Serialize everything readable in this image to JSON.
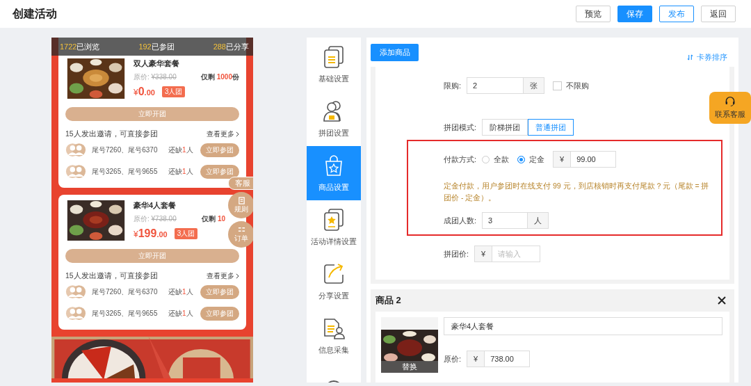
{
  "header": {
    "title": "创建活动",
    "buttons": [
      {
        "label": "预览",
        "kind": "default"
      },
      {
        "label": "保存",
        "kind": "primary"
      },
      {
        "label": "发布",
        "kind": "outline"
      },
      {
        "label": "返回",
        "kind": "default"
      }
    ]
  },
  "preview": {
    "stats": [
      {
        "count": "1722",
        "label": "已浏览"
      },
      {
        "count": "192",
        "label": "已参团"
      },
      {
        "count": "288",
        "label": "已分享"
      }
    ],
    "deals": [
      {
        "title": "双人豪华套餐",
        "original_label": "原价:",
        "original_price": "¥338.00",
        "stock_prefix": "仅剩",
        "stock": "1000",
        "stock_unit": "份",
        "currency": "¥",
        "price_int": "0",
        "price_dec": ".00",
        "group_size": "3人团",
        "start_button": "立即开团",
        "invite_text": "15人发出邀请，可直接参团",
        "more_link": "查看更多",
        "groups": [
          {
            "members": "尾号7260、尾号6370",
            "missing_prefix": "还缺",
            "missing": "1",
            "missing_suffix": "人",
            "join_button": "立即参团"
          },
          {
            "members": "尾号3265、尾号9655",
            "missing_prefix": "还缺",
            "missing": "1",
            "missing_suffix": "人",
            "join_button": "立即参团"
          }
        ]
      },
      {
        "title": "豪华4人套餐",
        "original_label": "原价:",
        "original_price": "¥738.00",
        "stock_prefix": "仅剩",
        "stock": "10",
        "currency": "¥",
        "price_int": "199",
        "price_dec": ".00",
        "group_size": "3人团",
        "start_button": "立即开团",
        "invite_text": "15人发出邀请，可直接参团",
        "more_link": "查看更多",
        "groups": [
          {
            "members": "尾号7260、尾号6370",
            "missing_prefix": "还缺",
            "missing": "1",
            "missing_suffix": "人",
            "join_button": "立即参团"
          },
          {
            "members": "尾号3265、尾号9655",
            "missing_prefix": "还缺",
            "missing": "1",
            "missing_suffix": "人",
            "join_button": "立即参团"
          }
        ]
      }
    ],
    "floating": [
      {
        "label": "客服",
        "kind": "tab"
      },
      {
        "label": "规则",
        "kind": "rules"
      },
      {
        "label": "订单",
        "kind": "orders"
      }
    ]
  },
  "nav": [
    {
      "label": "基础设置",
      "selected": false
    },
    {
      "label": "拼团设置",
      "selected": false
    },
    {
      "label": "商品设置",
      "selected": true
    },
    {
      "label": "活动详情设置",
      "selected": false
    },
    {
      "label": "分享设置",
      "selected": false
    },
    {
      "label": "信息采集",
      "selected": false
    },
    {
      "selected": false
    }
  ],
  "products": {
    "add_button": "添加商品",
    "sort_link": "卡券排序",
    "item1": {
      "limit": {
        "label": "限购:",
        "value": "2",
        "unit": "张",
        "unlimited": {
          "label": "不限购",
          "checked": false
        }
      },
      "mode": {
        "label": "拼团模式:",
        "options": [
          {
            "label": "阶梯拼团",
            "selected": false
          },
          {
            "label": "普通拼团",
            "selected": true
          }
        ]
      },
      "payment": {
        "label": "付款方式:",
        "options": [
          {
            "label": "全款",
            "selected": false
          },
          {
            "label": "定金",
            "selected": true
          }
        ],
        "currency": "¥",
        "amount": "99.00"
      },
      "note": "定金付款，用户参团时在线支付 99 元，到店核销时再支付尾款？元（尾款 = 拼团价 - 定金）。",
      "group_size": {
        "label": "成团人数:",
        "value": "3",
        "unit": "人"
      },
      "group_price": {
        "label": "拼团价:",
        "currency": "¥",
        "placeholder": "请输入"
      }
    },
    "item2": {
      "title": "商品 2",
      "replace_label": "替换",
      "name": "豪华4人套餐",
      "original_price": {
        "label": "原价:",
        "currency": "¥",
        "value": "738.00"
      }
    }
  },
  "support": {
    "label": "联系客服"
  }
}
